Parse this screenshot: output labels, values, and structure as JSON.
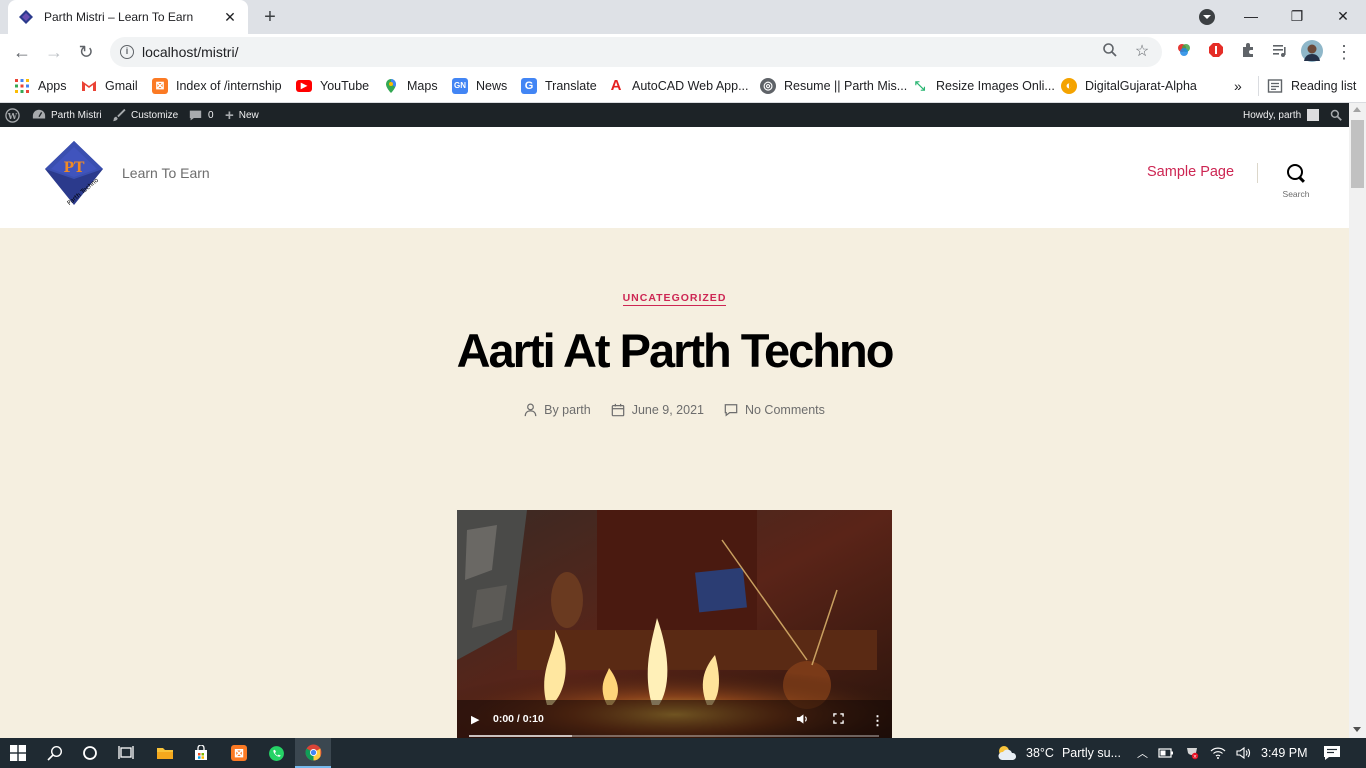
{
  "browser": {
    "tab_title": "Parth Mistri – Learn To Earn",
    "tab_close": "✕",
    "new_tab": "+",
    "window_minimize": "—",
    "window_restore": "❐",
    "window_close": "✕",
    "url": "localhost/mistri/",
    "back": "←",
    "forward": "→",
    "reload": "↻",
    "zoom_icon": "⚲",
    "bookmark_star": "☆",
    "menu_dots": "⋮"
  },
  "bookmarks": {
    "items": [
      {
        "label": "Apps",
        "icon": "apps-grid-icon",
        "color": "#4285f4"
      },
      {
        "label": "Gmail",
        "icon": "gmail-icon",
        "color": "#ea4335"
      },
      {
        "label": "Index of /internship",
        "icon": "xampp-icon",
        "color": "#fb7a24"
      },
      {
        "label": "YouTube",
        "icon": "youtube-icon",
        "color": "#ff0000"
      },
      {
        "label": "Maps",
        "icon": "maps-pin-icon",
        "color": "#34a853"
      },
      {
        "label": "News",
        "icon": "news-icon",
        "color": "#4285f4"
      },
      {
        "label": "Translate",
        "icon": "translate-icon",
        "color": "#4285f4"
      },
      {
        "label": "AutoCAD Web App...",
        "icon": "autocad-icon",
        "color": "#e51f1f"
      },
      {
        "label": "Resume || Parth Mis...",
        "icon": "globe-icon",
        "color": "#5f6368"
      },
      {
        "label": "Resize Images Onli...",
        "icon": "resize-icon",
        "color": "#2bb673"
      },
      {
        "label": "DigitalGujarat-Alpha",
        "icon": "digitalgujarat-icon",
        "color": "#f4a300"
      }
    ],
    "overflow": "»",
    "reading_list": "Reading list"
  },
  "admin_bar": {
    "site_name": "Parth Mistri",
    "customize": "Customize",
    "comments_count": "0",
    "new": "New",
    "howdy": "Howdy, parth"
  },
  "site": {
    "tagline": "Learn To Earn",
    "logo_text": "PT",
    "logo_sub": "Parth Techno",
    "nav_sample_page": "Sample Page",
    "search_label": "Search",
    "accent_color": "#cd2653"
  },
  "post": {
    "category": "UNCATEGORIZED",
    "title": "Aarti At Parth Techno",
    "author": "By parth",
    "date": "June 9, 2021",
    "comments": "No Comments"
  },
  "video": {
    "time": "0:00 / 0:10",
    "progress": 0.25
  },
  "taskbar": {
    "temperature": "38°C",
    "weather": "Partly su...",
    "time": "3:49 PM"
  }
}
